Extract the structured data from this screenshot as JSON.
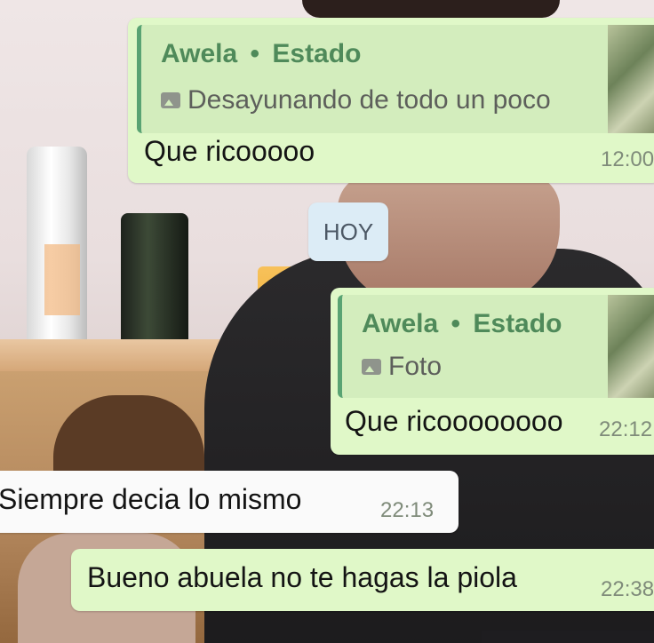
{
  "messages": {
    "first": {
      "reply_sender": "Awela",
      "reply_separator": "•",
      "reply_type": "Estado",
      "reply_preview": "Desayunando de todo un poco",
      "text": "Que ricooooo",
      "time": "12:00"
    },
    "date_chip": "HOY",
    "second": {
      "reply_sender": "Awela",
      "reply_separator": "•",
      "reply_type": "Estado",
      "reply_preview": "Foto",
      "text": "Que ricoooooooo",
      "time": "22:12"
    },
    "third": {
      "text": "Siempre decia lo mismo",
      "time": "22:13"
    },
    "fourth": {
      "text": "Bueno abuela no te hagas la piola",
      "time": "22:38"
    }
  },
  "icons": {
    "reply_photo": "photo-icon"
  }
}
